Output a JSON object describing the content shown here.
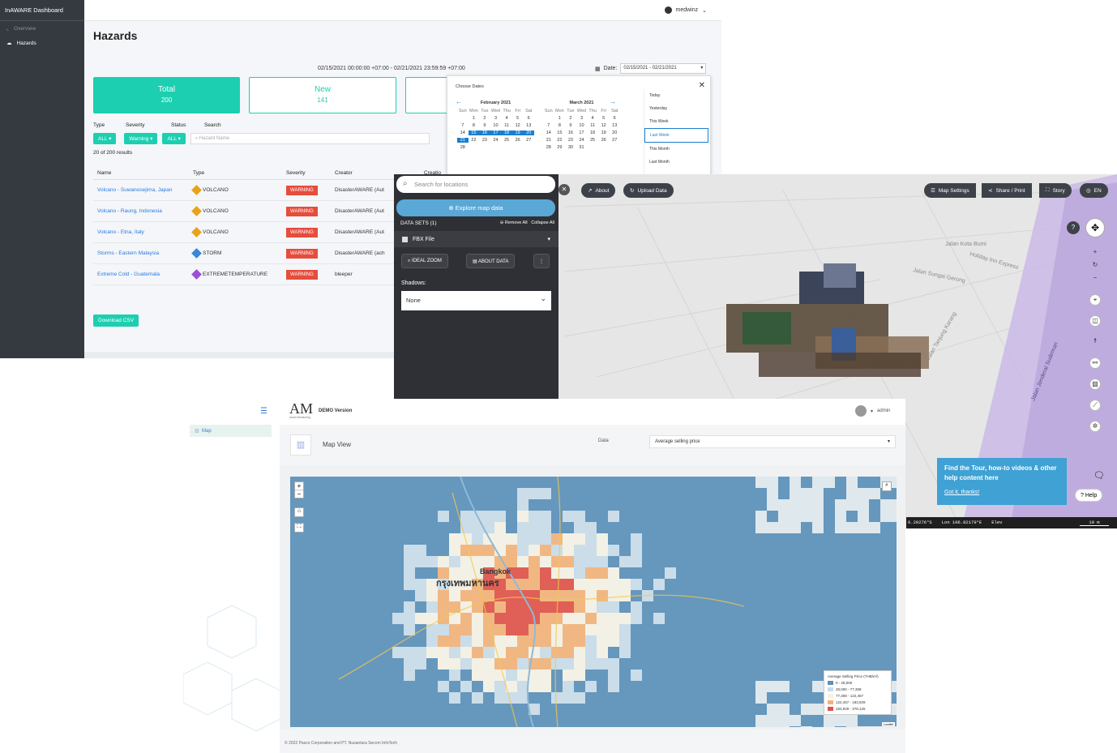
{
  "inaware": {
    "brand": "InAWARE Dashboard",
    "nav": [
      {
        "label": "Overview"
      },
      {
        "label": "Hazards"
      }
    ],
    "user": "medwinz",
    "title": "Hazards",
    "range": "02/15/2021 00:00:00 +07:00 - 02/21/2021 23:59:59 +07:00",
    "date_label": "Date:",
    "date_value": "02/15/2021 - 02/21/2021",
    "cards": [
      {
        "label": "Total",
        "value": "200"
      },
      {
        "label": "New",
        "value": "141"
      }
    ],
    "filters": {
      "type": "Type",
      "severity": "Severity",
      "status": "Status",
      "search": "Search",
      "type_val": "ALL",
      "severity_val": "Warning",
      "status_val": "ALL",
      "search_placeholder": "Hazard Name"
    },
    "results": "20 of 200 results",
    "columns": [
      "Name",
      "Type",
      "Severity",
      "Creator",
      "Creatio"
    ],
    "rows": [
      {
        "name": "Volcano - Suwanosejima, Japan",
        "type": "VOLCANO",
        "severity": "WARNING",
        "creator": "DisasterAWARE (Aut"
      },
      {
        "name": "Volcano - Raung, Indonesia",
        "type": "VOLCANO",
        "severity": "WARNING",
        "creator": "DisasterAWARE (Aut"
      },
      {
        "name": "Volcano - Etna, Italy",
        "type": "VOLCANO",
        "severity": "WARNING",
        "creator": "DisasterAWARE (Aut"
      },
      {
        "name": "Storms - Eastern Malaysia",
        "type": "STORM",
        "severity": "WARNING",
        "creator": "DisasterAWARE (ach"
      },
      {
        "name": "Extreme Cold - Guatemala",
        "type": "EXTREMETEMPERATURE",
        "severity": "WARNING",
        "creator": "bleeper"
      }
    ],
    "csv": "Download CSV",
    "calendar": {
      "title": "Choose Dates",
      "dow": [
        "Sun",
        "Mon",
        "Tue",
        "Wed",
        "Thu",
        "Fri",
        "Sat"
      ],
      "feb": {
        "name": "February 2021",
        "days": [
          "",
          "1",
          "2",
          "3",
          "4",
          "5",
          "6",
          "7",
          "8",
          "9",
          "10",
          "11",
          "12",
          "13",
          "14",
          "15",
          "16",
          "17",
          "18",
          "19",
          "20",
          "21",
          "22",
          "23",
          "24",
          "25",
          "26",
          "27",
          "28"
        ]
      },
      "mar": {
        "name": "March 2021",
        "days": [
          "",
          "1",
          "2",
          "3",
          "4",
          "5",
          "6",
          "7",
          "8",
          "9",
          "10",
          "11",
          "12",
          "13",
          "14",
          "15",
          "16",
          "17",
          "18",
          "19",
          "20",
          "21",
          "22",
          "23",
          "24",
          "25",
          "26",
          "27",
          "28",
          "29",
          "30",
          "31"
        ]
      },
      "presets": [
        "Today",
        "Yesterday",
        "This Week",
        "Last Week",
        "This Month",
        "Last Month"
      ]
    }
  },
  "viewer3d": {
    "search_placeholder": "Search for locations",
    "explore": "Explore map data",
    "datasets": "DATA SETS (1)",
    "remove_all": "Remove All",
    "collapse_all": "Collapse All",
    "file": "FBX File",
    "ideal_zoom": "IDEAL ZOOM",
    "about_data": "ABOUT DATA",
    "shadows_label": "Shadows:",
    "shadows_value": "None",
    "about": "About",
    "upload": "Upload Data",
    "map_settings": "Map Settings",
    "share": "Share / Print",
    "story": "Story",
    "lang": "EN",
    "tip_title": "Find the Tour, how-to videos & other help content here",
    "tip_link": "Got it, thanks!",
    "help": "Help",
    "status": {
      "lat": "6.20276°S",
      "lon": "Lon  106.82179°E",
      "elev": "Elev",
      "scale": "10 m"
    },
    "streets": [
      "Jalan Kota Bumi",
      "Jalan Sungai Gerong",
      "Holiday Inn Express",
      "Jalan Tanjung Karang",
      "Jalan Jenderal Sudirman"
    ]
  },
  "am": {
    "logo": "AM",
    "logo_sub": "Asset Monitoring",
    "demo": "DEMO Version",
    "user": "admin",
    "nav_map": "Map",
    "view_title": "Map View",
    "data_label": "Data",
    "data_value": "Average selling price",
    "city": "Bangkok",
    "city_th": "กรุงเทพมหานคร",
    "legend_title": "Average Selling Price (THB/m²)",
    "legend": [
      {
        "label": "0 - 28,000",
        "color": "#5b8fb9"
      },
      {
        "label": "28,000 - 77,308",
        "color": "#c8dbe8"
      },
      {
        "label": "77,308 - 122,457",
        "color": "#f4f1e4"
      },
      {
        "label": "122,457 - 183,929",
        "color": "#f2b27a"
      },
      {
        "label": "183,929 - 378,125",
        "color": "#e0524a"
      }
    ],
    "attribution": "Leaflet",
    "footer": "© 2022 Pasco Corporation and PT. Nusantara Secom InfoTech"
  }
}
